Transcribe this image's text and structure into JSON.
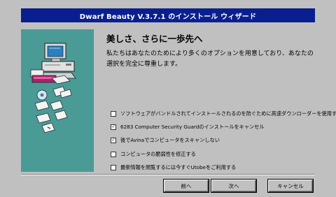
{
  "window": {
    "title": "Dwarf Beauty V.3.7.1 のインストール ウィザード"
  },
  "main": {
    "heading": "美しさ、さらに一歩先へ",
    "description": "私たちはあなたのためにより多くのオプションを用意しており、あなたの選択を完全に尊重します。"
  },
  "options": [
    {
      "label": "ソフトウェアがバンドルされてインストールされるのを防ぐために高速ダウンローダーを使用する",
      "checked": false
    },
    {
      "label": "6283 Computer Security Guardのインストールをキャンセル",
      "checked": true
    },
    {
      "label": "後でAvinaでコンピュータをスキャンしない",
      "checked": true
    },
    {
      "label": "コンピュータの脆弱性を修正する",
      "checked": false
    },
    {
      "label": "最新情報を閲覧するには今すぐUtobeをご利用する",
      "checked": false
    }
  ],
  "buttons": {
    "back": "前へ",
    "next": "次へ",
    "cancel": "キャンセル"
  },
  "colors": {
    "titlebar": "#0a1f8f",
    "side_panel": "#4a9a96",
    "background": "#c0c0c0"
  }
}
